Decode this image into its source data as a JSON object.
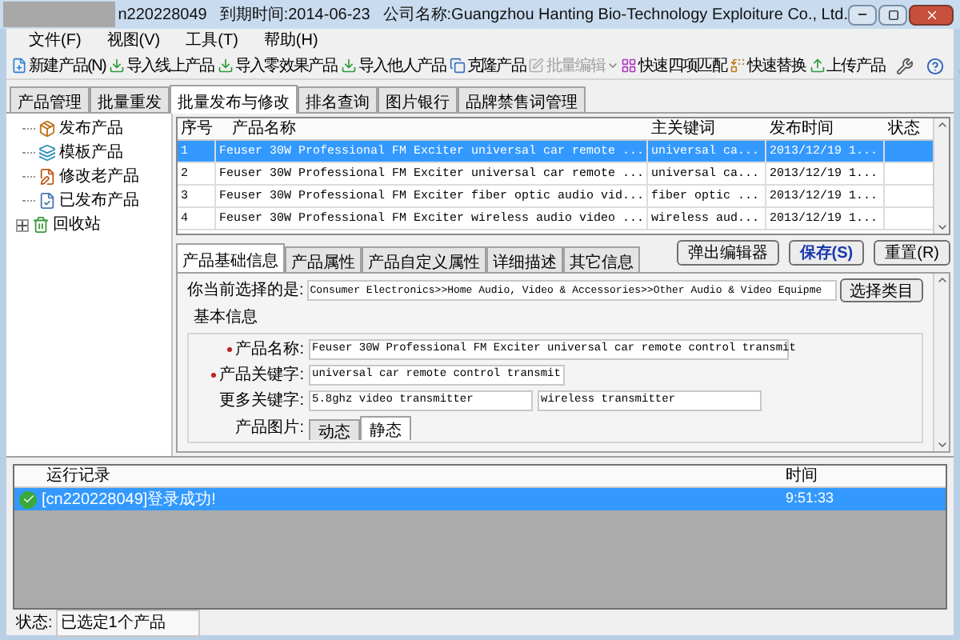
{
  "window": {
    "title_parts": [
      "n220228049",
      "到期时间:2014-06-23",
      "公司名称:Guangzhou Hanting Bio-Technology Exploiture Co., Ltd."
    ]
  },
  "menu": [
    "文件(F)",
    "视图(V)",
    "工具(T)",
    "帮助(H)"
  ],
  "toolbar": [
    {
      "label": "新建产品(N)",
      "kind": "button",
      "disabled": false
    },
    {
      "label": "导入线上产品",
      "kind": "button",
      "disabled": false
    },
    {
      "label": "导入零效果产品",
      "kind": "button",
      "disabled": false
    },
    {
      "label": "导入他人产品",
      "kind": "button",
      "disabled": false
    },
    {
      "label": "克隆产品",
      "kind": "button",
      "disabled": false
    },
    {
      "label": "批量编辑",
      "kind": "split",
      "disabled": true
    },
    {
      "label": "快速四项匹配",
      "kind": "button",
      "disabled": false
    },
    {
      "label": "快速替换",
      "kind": "button",
      "disabled": false
    },
    {
      "label": "上传产品",
      "kind": "button",
      "disabled": false
    }
  ],
  "main_tabs": [
    {
      "label": "产品管理",
      "selected": false
    },
    {
      "label": "批量重发",
      "selected": false
    },
    {
      "label": "批量发布与修改",
      "selected": true
    },
    {
      "label": "排名查询",
      "selected": false
    },
    {
      "label": "图片银行",
      "selected": false
    },
    {
      "label": "品牌禁售词管理",
      "selected": false
    }
  ],
  "tree": [
    {
      "label": "发布产品",
      "kind": "leaf"
    },
    {
      "label": "模板产品",
      "kind": "leaf"
    },
    {
      "label": "修改老产品",
      "kind": "leaf"
    },
    {
      "label": "已发布产品",
      "kind": "leaf"
    },
    {
      "label": "回收站",
      "kind": "folder",
      "expanded": false
    }
  ],
  "product_table": {
    "columns": [
      "序号",
      "产品名称",
      "主关键词",
      "发布时间",
      "状态"
    ],
    "rows": [
      {
        "cells": [
          "1",
          "Feuser 30W Professional FM Exciter universal car remote ...",
          "universal ca...",
          "2013/12/19 1..."
        ],
        "selected": true
      },
      {
        "cells": [
          "2",
          "Feuser 30W Professional FM Exciter universal car remote ...",
          "universal ca...",
          "2013/12/19 1..."
        ],
        "selected": false
      },
      {
        "cells": [
          "3",
          "Feuser 30W Professional FM Exciter fiber optic audio vid...",
          "fiber optic ...",
          "2013/12/19 1..."
        ],
        "selected": false
      },
      {
        "cells": [
          "4",
          "Feuser 30W Professional FM Exciter wireless audio video ...",
          "wireless aud...",
          "2013/12/19 1..."
        ],
        "selected": false
      }
    ]
  },
  "detail_tabs": [
    {
      "label": "产品基础信息",
      "selected": true
    },
    {
      "label": "产品属性",
      "selected": false
    },
    {
      "label": "产品自定义属性",
      "selected": false
    },
    {
      "label": "详细描述",
      "selected": false
    },
    {
      "label": "其它信息",
      "selected": false
    }
  ],
  "actions": [
    {
      "label": "弹出编辑器",
      "kind": "normal"
    },
    {
      "label": "保存(S)",
      "kind": "primary"
    },
    {
      "label": "重置(R)",
      "kind": "normal"
    }
  ],
  "form": {
    "category_label": "你当前选择的是:",
    "category_value": "Consumer Electronics>>Home Audio, Video & Accessories>>Other Audio & Video Equipme",
    "category_button": "选择类目",
    "group_title": "基本信息",
    "fields": [
      {
        "label": "产品名称:",
        "required": true,
        "values": [
          "Feuser 30W Professional FM Exciter universal car remote control transmit"
        ]
      },
      {
        "label": "产品关键字:",
        "required": true,
        "values": [
          "universal car remote control transmit"
        ]
      },
      {
        "label": "更多关键字:",
        "required": false,
        "values": [
          "5.8ghz video transmitter",
          "wireless transmitter"
        ]
      }
    ],
    "image_label": "产品图片:",
    "image_tabs": [
      {
        "label": "动态",
        "selected": false
      },
      {
        "label": "静态",
        "selected": true
      }
    ]
  },
  "log": {
    "columns": [
      "运行记录",
      "时间"
    ],
    "rows": [
      {
        "message": "[cn220228049]登录成功!",
        "time": "9:51:33",
        "kind": "success",
        "selected": true
      }
    ]
  },
  "status_bar": {
    "label": "状态:",
    "value": "已选定1个产品"
  }
}
